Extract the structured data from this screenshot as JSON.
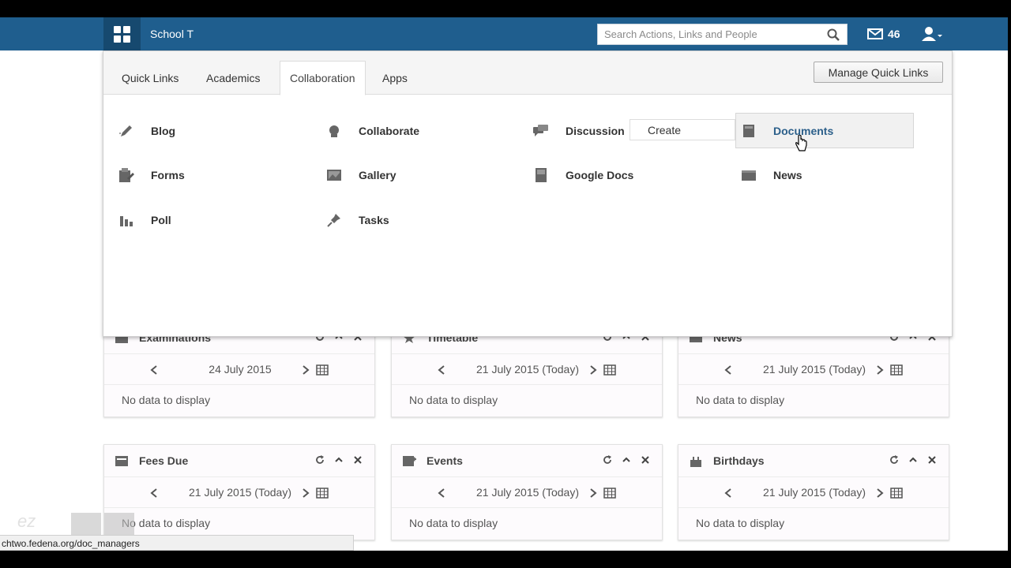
{
  "navbar": {
    "school_name": "School T",
    "search_placeholder": "Search Actions, Links and People",
    "mail_count": "46"
  },
  "menu": {
    "tabs": [
      {
        "label": "Quick Links"
      },
      {
        "label": "Academics"
      },
      {
        "label": "Collaboration"
      },
      {
        "label": "Apps"
      }
    ],
    "active_tab": "Collaboration",
    "manage_label": "Manage Quick Links",
    "items": [
      {
        "label": "Blog",
        "icon": "pencil-icon"
      },
      {
        "label": "Collaborate",
        "icon": "badge-icon"
      },
      {
        "label": "Discussion",
        "icon": "chat-icon"
      },
      {
        "label": "Documents",
        "icon": "book-icon"
      },
      {
        "label": "Forms",
        "icon": "forms-icon"
      },
      {
        "label": "Gallery",
        "icon": "picture-icon"
      },
      {
        "label": "Google Docs",
        "icon": "document-icon"
      },
      {
        "label": "News",
        "icon": "news-icon"
      },
      {
        "label": "Poll",
        "icon": "bar-chart-icon"
      },
      {
        "label": "Tasks",
        "icon": "pin-icon"
      }
    ],
    "create_label": "Create"
  },
  "widgets": [
    {
      "title": "Examinations",
      "date": "24 July 2015",
      "body": "No data to display"
    },
    {
      "title": "Timetable",
      "date": "21 July 2015 (Today)",
      "body": "No data to display"
    },
    {
      "title": "News",
      "date": "21 July 2015 (Today)",
      "body": "No data to display"
    },
    {
      "title": "Fees Due",
      "date": "21 July 2015 (Today)",
      "body": "No data to display"
    },
    {
      "title": "Events",
      "date": "21 July 2015 (Today)",
      "body": "No data to display"
    },
    {
      "title": "Birthdays",
      "date": "21 July 2015 (Today)",
      "body": "No data to display"
    }
  ],
  "status_url": "chtwo.fedena.org/doc_managers",
  "watermark": "ez",
  "colors": {
    "navbar": "#1f5e8e",
    "apps_button": "#16496f",
    "link_highlight": "#2b5f8a"
  }
}
